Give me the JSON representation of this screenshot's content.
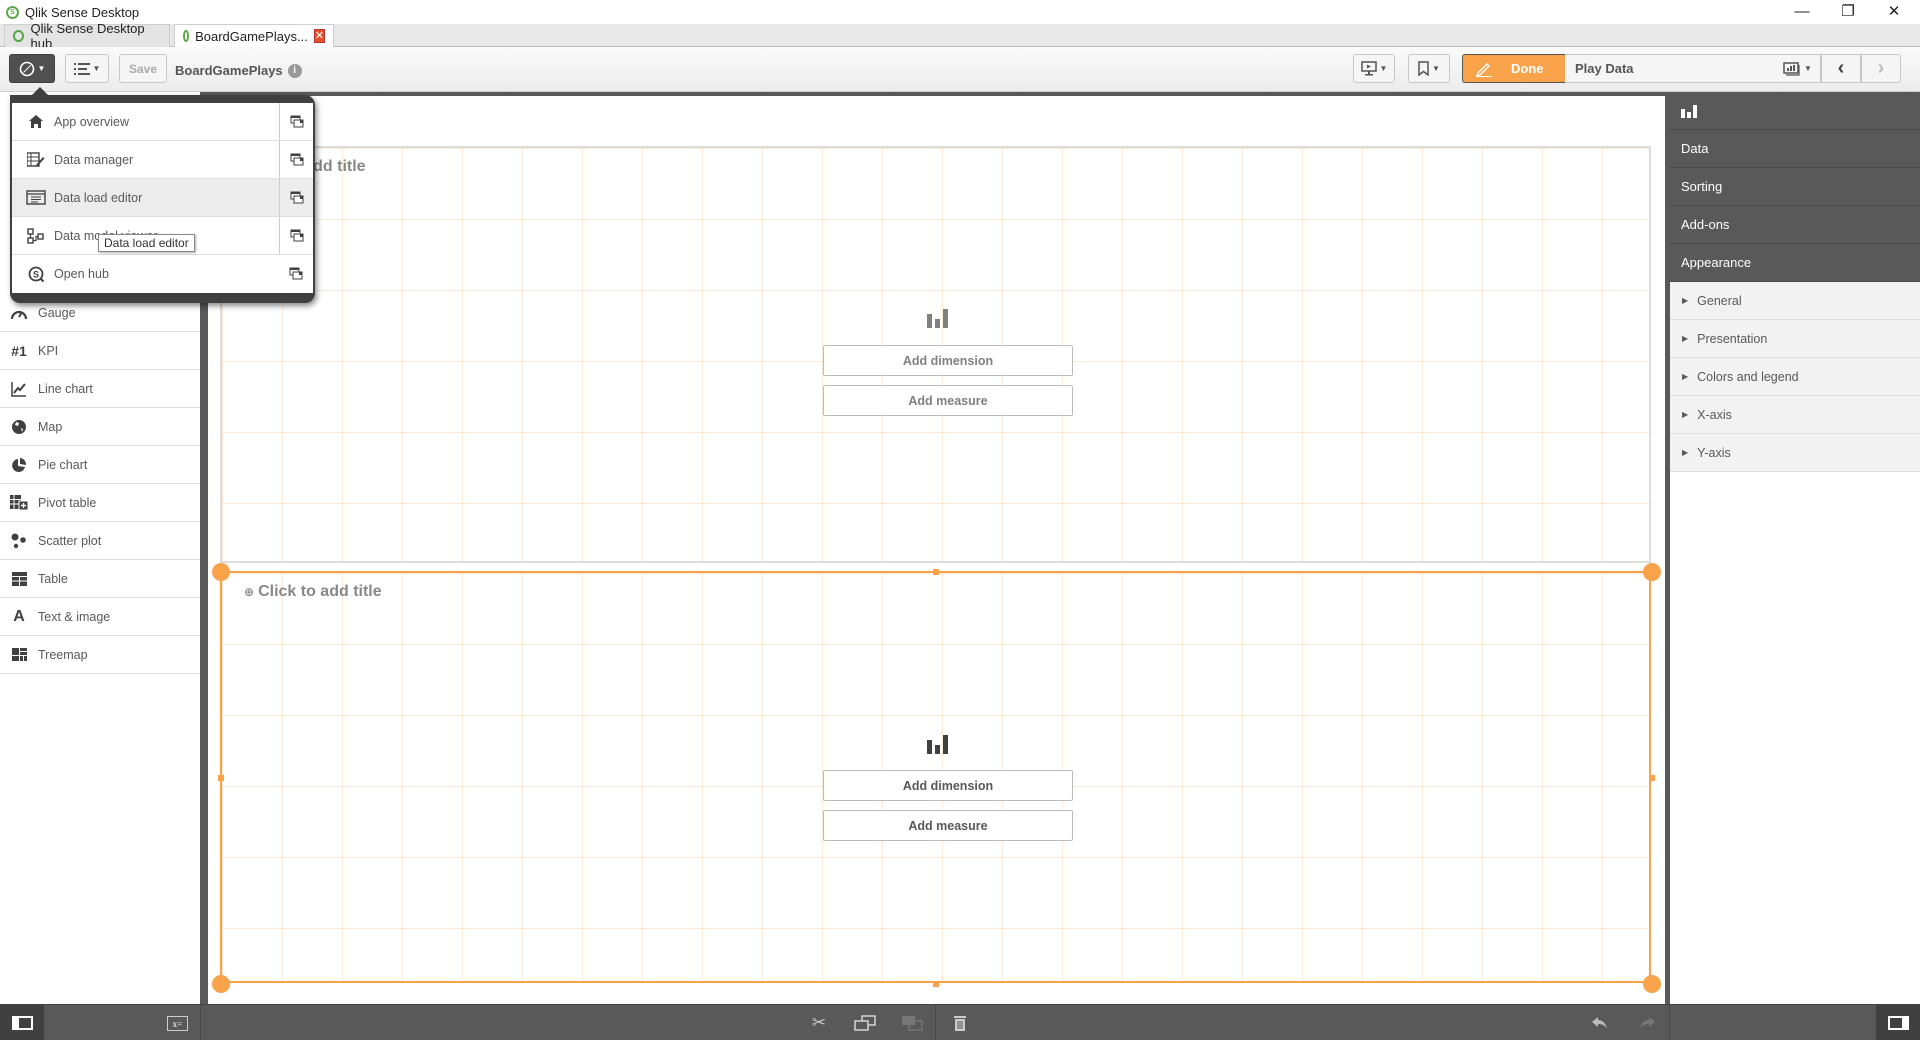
{
  "window": {
    "title": "Qlik Sense Desktop",
    "controls": {
      "minimize": "—",
      "restore": "❐",
      "close": "✕"
    }
  },
  "tabs": [
    {
      "label": "Qlik Sense Desktop hub",
      "active": false
    },
    {
      "label": "BoardGamePlays...",
      "active": true,
      "close": "✕"
    }
  ],
  "toolbar": {
    "navigation_icon": "compass-icon",
    "sheets_icon": "list-icon",
    "save_label": "Save",
    "app_title": "BoardGamePlays",
    "info_icon": "i",
    "done_label": "Done",
    "sheet_name": "Play Data",
    "prev_icon": "‹",
    "next_icon": "›"
  },
  "nav_menu": {
    "items": [
      {
        "label": "App overview",
        "icon": "home-icon"
      },
      {
        "label": "Data manager",
        "icon": "data-manager-icon"
      },
      {
        "label": "Data load editor",
        "icon": "data-load-editor-icon",
        "hovered": true
      },
      {
        "label": "Data model viewer",
        "icon": "data-model-viewer-icon"
      },
      {
        "label": "Open hub",
        "icon": "hub-icon"
      }
    ],
    "tooltip": "Data load editor"
  },
  "left_panel": {
    "items": [
      {
        "label": "Gauge",
        "icon": "gauge-icon",
        "glyph": "◔"
      },
      {
        "label": "KPI",
        "icon": "kpi-icon",
        "glyph": "#1"
      },
      {
        "label": "Line chart",
        "icon": "line-chart-icon",
        "glyph": "📈"
      },
      {
        "label": "Map",
        "icon": "map-icon",
        "glyph": "●"
      },
      {
        "label": "Pie chart",
        "icon": "pie-chart-icon",
        "glyph": "◕"
      },
      {
        "label": "Pivot table",
        "icon": "pivot-table-icon",
        "glyph": "▦"
      },
      {
        "label": "Scatter plot",
        "icon": "scatter-plot-icon",
        "glyph": "⁘"
      },
      {
        "label": "Table",
        "icon": "table-icon",
        "glyph": "▤"
      },
      {
        "label": "Text & image",
        "icon": "text-image-icon",
        "glyph": "A"
      },
      {
        "label": "Treemap",
        "icon": "treemap-icon",
        "glyph": "▚"
      }
    ]
  },
  "charts": [
    {
      "title": "Click to add title",
      "add_dimension": "Add dimension",
      "add_measure": "Add measure",
      "selected": false
    },
    {
      "title": "Click to add title",
      "add_dimension": "Add dimension",
      "add_measure": "Add measure",
      "selected": true
    }
  ],
  "right_panel": {
    "header_icon": "bar-chart-icon",
    "sections": [
      "Data",
      "Sorting",
      "Add-ons",
      "Appearance"
    ],
    "appearance_items": [
      "General",
      "Presentation",
      "Colors and legend",
      "X-axis",
      "Y-axis"
    ]
  },
  "bottom_bar": {
    "icons": [
      "toggle-left-panel-icon",
      "variables-icon",
      "cut-icon",
      "copy-icon",
      "paste-icon",
      "delete-icon",
      "undo-icon",
      "redo-icon",
      "toggle-right-panel-icon"
    ]
  },
  "colors": {
    "accent": "#f8a24a",
    "panel_dark": "#595959",
    "menu_dark": "#404040",
    "text": "#595959"
  }
}
